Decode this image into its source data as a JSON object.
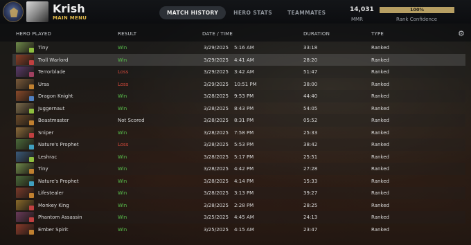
{
  "profile": {
    "username": "Krish",
    "main_menu": "MAIN MENU"
  },
  "tabs": [
    {
      "label": "MATCH HISTORY",
      "active": true
    },
    {
      "label": "HERO STATS",
      "active": false
    },
    {
      "label": "TEAMMATES",
      "active": false
    }
  ],
  "mmr": {
    "value": "14,031",
    "label": "MMR"
  },
  "rank_confidence": {
    "percent_text": "100%",
    "fill_fraction": 1.0,
    "label": "Rank Confidence",
    "color": "#b79f63"
  },
  "table": {
    "headers": [
      "HERO PLAYED",
      "RESULT",
      "DATE / TIME",
      "DURATION",
      "TYPE"
    ],
    "settings_icon": "gear-icon",
    "rows": [
      {
        "hero": "Tiny",
        "result": "Win",
        "date": "3/29/2025",
        "time": "5:16 AM",
        "duration": "33:18",
        "type": "Ranked"
      },
      {
        "hero": "Troll Warlord",
        "result": "Win",
        "date": "3/29/2025",
        "time": "4:41 AM",
        "duration": "28:20",
        "type": "Ranked"
      },
      {
        "hero": "Terrorblade",
        "result": "Loss",
        "date": "3/29/2025",
        "time": "3:42 AM",
        "duration": "51:47",
        "type": "Ranked"
      },
      {
        "hero": "Ursa",
        "result": "Loss",
        "date": "3/29/2025",
        "time": "10:51 PM",
        "duration": "38:00",
        "type": "Ranked"
      },
      {
        "hero": "Dragon Knight",
        "result": "Win",
        "date": "3/28/2025",
        "time": "9:53 PM",
        "duration": "44:40",
        "type": "Ranked"
      },
      {
        "hero": "Juggernaut",
        "result": "Win",
        "date": "3/28/2025",
        "time": "8:43 PM",
        "duration": "54:05",
        "type": "Ranked"
      },
      {
        "hero": "Beastmaster",
        "result": "Not Scored",
        "date": "3/28/2025",
        "time": "8:31 PM",
        "duration": "05:52",
        "type": "Ranked"
      },
      {
        "hero": "Sniper",
        "result": "Win",
        "date": "3/28/2025",
        "time": "7:58 PM",
        "duration": "25:33",
        "type": "Ranked"
      },
      {
        "hero": "Nature's Prophet",
        "result": "Loss",
        "date": "3/28/2025",
        "time": "5:53 PM",
        "duration": "38:42",
        "type": "Ranked"
      },
      {
        "hero": "Leshrac",
        "result": "Win",
        "date": "3/28/2025",
        "time": "5:17 PM",
        "duration": "25:51",
        "type": "Ranked"
      },
      {
        "hero": "Tiny",
        "result": "Win",
        "date": "3/28/2025",
        "time": "4:42 PM",
        "duration": "27:28",
        "type": "Ranked"
      },
      {
        "hero": "Nature's Prophet",
        "result": "Win",
        "date": "3/28/2025",
        "time": "4:14 PM",
        "duration": "15:33",
        "type": "Ranked"
      },
      {
        "hero": "Lifestealer",
        "result": "Win",
        "date": "3/28/2025",
        "time": "3:13 PM",
        "duration": "39:27",
        "type": "Ranked"
      },
      {
        "hero": "Monkey King",
        "result": "Win",
        "date": "3/28/2025",
        "time": "2:28 PM",
        "duration": "28:25",
        "type": "Ranked"
      },
      {
        "hero": "Phantom Assassin",
        "result": "Win",
        "date": "3/25/2025",
        "time": "4:45 AM",
        "duration": "24:13",
        "type": "Ranked"
      },
      {
        "hero": "Ember Spirit",
        "result": "Win",
        "date": "3/25/2025",
        "time": "4:15 AM",
        "duration": "23:47",
        "type": "Ranked"
      }
    ]
  }
}
